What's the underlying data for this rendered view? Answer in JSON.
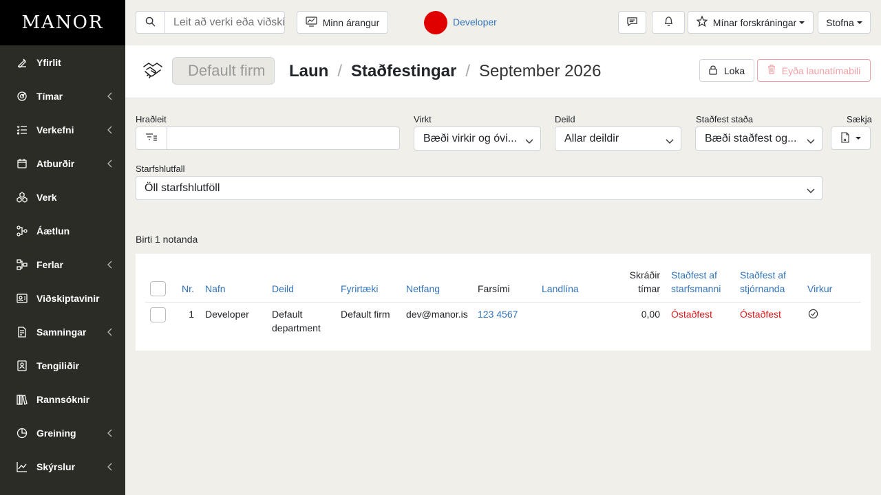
{
  "brand": "MANOR",
  "sidebar": {
    "items": [
      {
        "label": "Yfirlit",
        "icon": "pen-icon",
        "has_submenu": false
      },
      {
        "label": "Tímar",
        "icon": "target-clock-icon",
        "has_submenu": true
      },
      {
        "label": "Verkefni",
        "icon": "list-check-icon",
        "has_submenu": true
      },
      {
        "label": "Atburðir",
        "icon": "calendar-icon",
        "has_submenu": true
      },
      {
        "label": "Verk",
        "icon": "cubes-icon",
        "has_submenu": false
      },
      {
        "label": "Áætlun",
        "icon": "network-icon",
        "has_submenu": false
      },
      {
        "label": "Ferlar",
        "icon": "flow-icon",
        "has_submenu": true
      },
      {
        "label": "Viðskiptavinir",
        "icon": "id-card-icon",
        "has_submenu": false
      },
      {
        "label": "Samningar",
        "icon": "contract-icon",
        "has_submenu": true
      },
      {
        "label": "Tengiliðir",
        "icon": "contact-book-icon",
        "has_submenu": false
      },
      {
        "label": "Rannsóknir",
        "icon": "books-icon",
        "has_submenu": false
      },
      {
        "label": "Greining",
        "icon": "pie-chart-icon",
        "has_submenu": true
      },
      {
        "label": "Skýrslur",
        "icon": "line-chart-icon",
        "has_submenu": true
      }
    ]
  },
  "topbar": {
    "search_placeholder": "Leit að verki eða viðskiptavini",
    "achievements_label": "Minn árangur",
    "user_name": "Developer",
    "user_color": "#e00000",
    "favorites_label": "Mínar forskráningar",
    "create_label": "Stofna"
  },
  "header": {
    "firm_value": "Default firm",
    "crumb_1": "Laun",
    "crumb_2": "Staðfestingar",
    "crumb_sep": "/",
    "period": "September 2026",
    "lock_label": "Loka",
    "delete_label": "Eyða launatímabili"
  },
  "filters": {
    "quick_search_label": "Hraðleit",
    "quick_search_value": "",
    "active_label": "Virkt",
    "active_value": "Bæði virkir og óvi...",
    "department_label": "Deild",
    "department_value": "Allar deildir",
    "confirmed_label": "Staðfest staða",
    "confirmed_value": "Bæði staðfest og...",
    "export_label": "Sækja",
    "employment_label": "Starfshlutfall",
    "employment_value": "Öll starfshlutföll"
  },
  "result_count": "Birti 1 notanda",
  "table": {
    "headers": {
      "nr": "Nr.",
      "name": "Nafn",
      "department": "Deild",
      "company": "Fyrirtæki",
      "email": "Netfang",
      "mobile": "Farsími",
      "landline": "Landlína",
      "hours_1": "Skráðir",
      "hours_2": "tímar",
      "by_employee_1": "Staðfest af",
      "by_employee_2": "starfsmanni",
      "by_manager_1": "Staðfest af",
      "by_manager_2": "stjórnanda",
      "active": "Virkur"
    },
    "rows": [
      {
        "nr": "1",
        "name": "Developer",
        "department_1": "Default",
        "department_2": "department",
        "company": "Default firm",
        "email": "dev@manor.is",
        "mobile": "123 4567",
        "landline": "",
        "hours": "0,00",
        "by_employee": "Óstaðfest",
        "by_manager": "Óstaðfest",
        "active": true
      }
    ]
  },
  "colors": {
    "sidebar_bg": "#2c2c27",
    "accent_blue": "#3273b8",
    "unconfirmed_red": "#dc1e1e",
    "danger_light": "#f1a0a5"
  }
}
